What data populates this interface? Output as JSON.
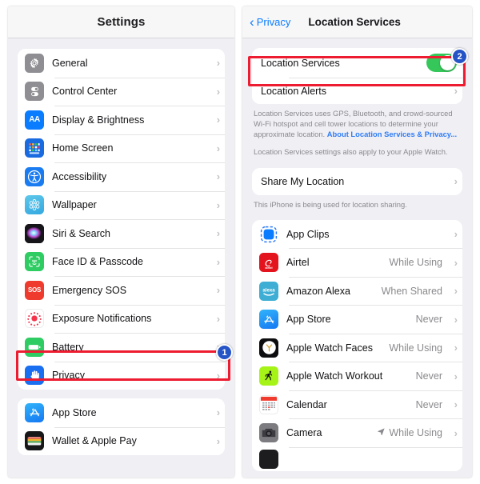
{
  "left_panel": {
    "header_title": "Settings",
    "groups": [
      {
        "items": [
          {
            "label": "General",
            "icon": "gear-icon"
          },
          {
            "label": "Control Center",
            "icon": "control-center-icon"
          },
          {
            "label": "Display & Brightness",
            "icon": "display-brightness-icon"
          },
          {
            "label": "Home Screen",
            "icon": "home-screen-icon"
          },
          {
            "label": "Accessibility",
            "icon": "accessibility-icon"
          },
          {
            "label": "Wallpaper",
            "icon": "wallpaper-icon"
          },
          {
            "label": "Siri & Search",
            "icon": "siri-icon"
          },
          {
            "label": "Face ID & Passcode",
            "icon": "face-id-icon"
          },
          {
            "label": "Emergency SOS",
            "icon": "emergency-sos-icon"
          },
          {
            "label": "Exposure Notifications",
            "icon": "exposure-notifications-icon"
          },
          {
            "label": "Battery",
            "icon": "battery-icon"
          },
          {
            "label": "Privacy",
            "icon": "privacy-hand-icon"
          }
        ]
      },
      {
        "items": [
          {
            "label": "App Store",
            "icon": "app-store-icon"
          },
          {
            "label": "Wallet & Apple Pay",
            "icon": "wallet-icon"
          }
        ]
      }
    ]
  },
  "right_panel": {
    "back_label": "Privacy",
    "header_title": "Location Services",
    "group_toggle": {
      "toggle_row_label": "Location Services",
      "toggle_on": true,
      "alerts_row_label": "Location Alerts"
    },
    "footer_1_text": "Location Services uses GPS, Bluetooth, and crowd-sourced Wi-Fi hotspot and cell tower locations to determine your approximate location. ",
    "footer_1_link": "About Location Services & Privacy...",
    "footer_2_text": "Location Services settings also apply to your Apple Watch.",
    "share_row_label": "Share My Location",
    "share_footer": "This iPhone is being used for location sharing.",
    "apps": [
      {
        "label": "App Clips",
        "value": "",
        "icon": "app-clips-icon",
        "arrow": false
      },
      {
        "label": "Airtel",
        "value": "While Using",
        "icon": "airtel-icon",
        "arrow": false
      },
      {
        "label": "Amazon Alexa",
        "value": "When Shared",
        "icon": "amazon-alexa-icon",
        "arrow": false
      },
      {
        "label": "App Store",
        "value": "Never",
        "icon": "app-store-icon",
        "arrow": false
      },
      {
        "label": "Apple Watch Faces",
        "value": "While Using",
        "icon": "apple-watch-faces-icon",
        "arrow": false
      },
      {
        "label": "Apple Watch Workout",
        "value": "Never",
        "icon": "apple-watch-workout-icon",
        "arrow": false
      },
      {
        "label": "Calendar",
        "value": "Never",
        "icon": "calendar-icon",
        "arrow": false
      },
      {
        "label": "Camera",
        "value": "While Using",
        "icon": "camera-icon",
        "arrow": true
      }
    ]
  },
  "annotations": {
    "badge_1": "1",
    "badge_2": "2",
    "highlight_color": "#ed1c30",
    "badge_color": "#2554c7"
  },
  "icons": {
    "chevron": "›",
    "back_chevron": "‹",
    "location_arrow": "➤"
  }
}
